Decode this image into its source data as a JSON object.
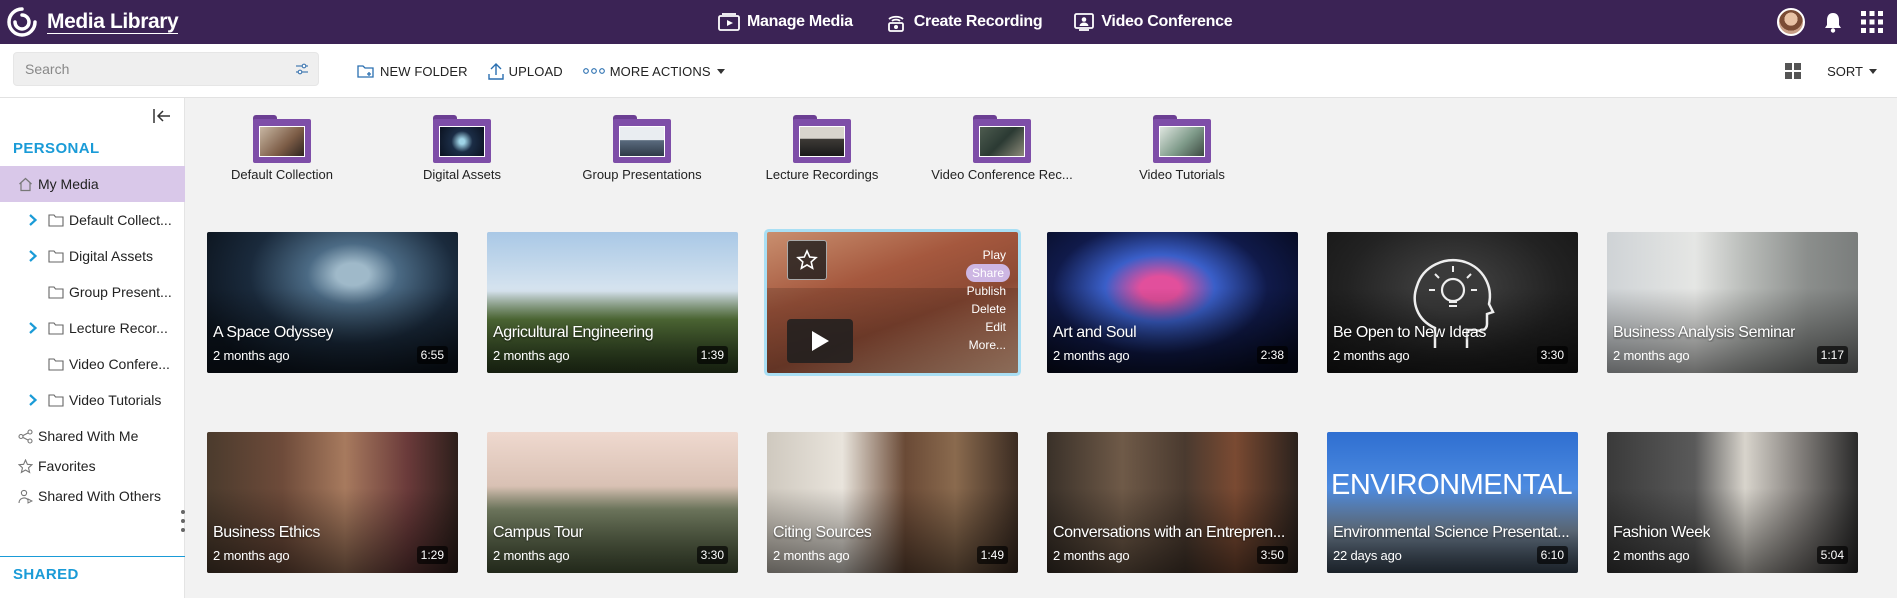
{
  "app": {
    "title": "Media Library",
    "nav": [
      {
        "label": "Manage Media",
        "icon": "manage-media-icon"
      },
      {
        "label": "Create Recording",
        "icon": "create-recording-icon"
      },
      {
        "label": "Video Conference",
        "icon": "video-conference-icon"
      }
    ],
    "right_icons": [
      "user-avatar",
      "bell-icon",
      "apps-grid-icon"
    ]
  },
  "toolbar": {
    "search_placeholder": "Search",
    "new_folder": "NEW FOLDER",
    "upload": "UPLOAD",
    "more_actions": "MORE ACTIONS",
    "sort": "SORT"
  },
  "sidebar": {
    "personal_title": "PERSONAL",
    "shared_title": "SHARED",
    "my_media": "My Media",
    "folders": [
      {
        "label": "Default Collect...",
        "expandable": true
      },
      {
        "label": "Digital Assets",
        "expandable": true
      },
      {
        "label": "Group Present...",
        "expandable": false
      },
      {
        "label": "Lecture Recor...",
        "expandable": true
      },
      {
        "label": "Video Confere...",
        "expandable": false
      },
      {
        "label": "Video Tutorials",
        "expandable": true
      }
    ],
    "links": [
      {
        "label": "Shared With Me",
        "icon": "share-icon"
      },
      {
        "label": "Favorites",
        "icon": "star-icon"
      },
      {
        "label": "Shared With Others",
        "icon": "user-share-icon"
      }
    ]
  },
  "folders": [
    {
      "label": "Default Collection"
    },
    {
      "label": "Digital Assets"
    },
    {
      "label": "Group Presentations"
    },
    {
      "label": "Lecture Recordings"
    },
    {
      "label": "Video Conference Rec..."
    },
    {
      "label": "Video Tutorials"
    }
  ],
  "media": [
    {
      "title": "A Space Odyssey",
      "date": "2 months ago",
      "duration": "6:55"
    },
    {
      "title": "Agricultural Engineering",
      "date": "2 months ago",
      "duration": "1:39"
    },
    {
      "title": "",
      "date": "",
      "duration": ""
    },
    {
      "title": "Art and Soul",
      "date": "2 months ago",
      "duration": "2:38"
    },
    {
      "title": "Be Open to New Ideas",
      "date": "2 months ago",
      "duration": "3:30"
    },
    {
      "title": "Business Analysis Seminar",
      "date": "2 months ago",
      "duration": "1:17"
    },
    {
      "title": "Business Ethics",
      "date": "2 months ago",
      "duration": "1:29"
    },
    {
      "title": "Campus Tour",
      "date": "2 months ago",
      "duration": "3:30"
    },
    {
      "title": "Citing Sources",
      "date": "2 months ago",
      "duration": "1:49"
    },
    {
      "title": "Conversations with an Entrepren...",
      "date": "2 months ago",
      "duration": "3:50"
    },
    {
      "title": "Environmental Science Presentat...",
      "date": "22 days ago",
      "duration": "6:10",
      "overlay_text": "ENVIRONMENTAL SCIENCE"
    },
    {
      "title": "Fashion Week",
      "date": "2 months ago",
      "duration": "5:04"
    }
  ],
  "hover_menu": [
    "Play",
    "Share",
    "Publish",
    "Delete",
    "Edit",
    "More..."
  ]
}
